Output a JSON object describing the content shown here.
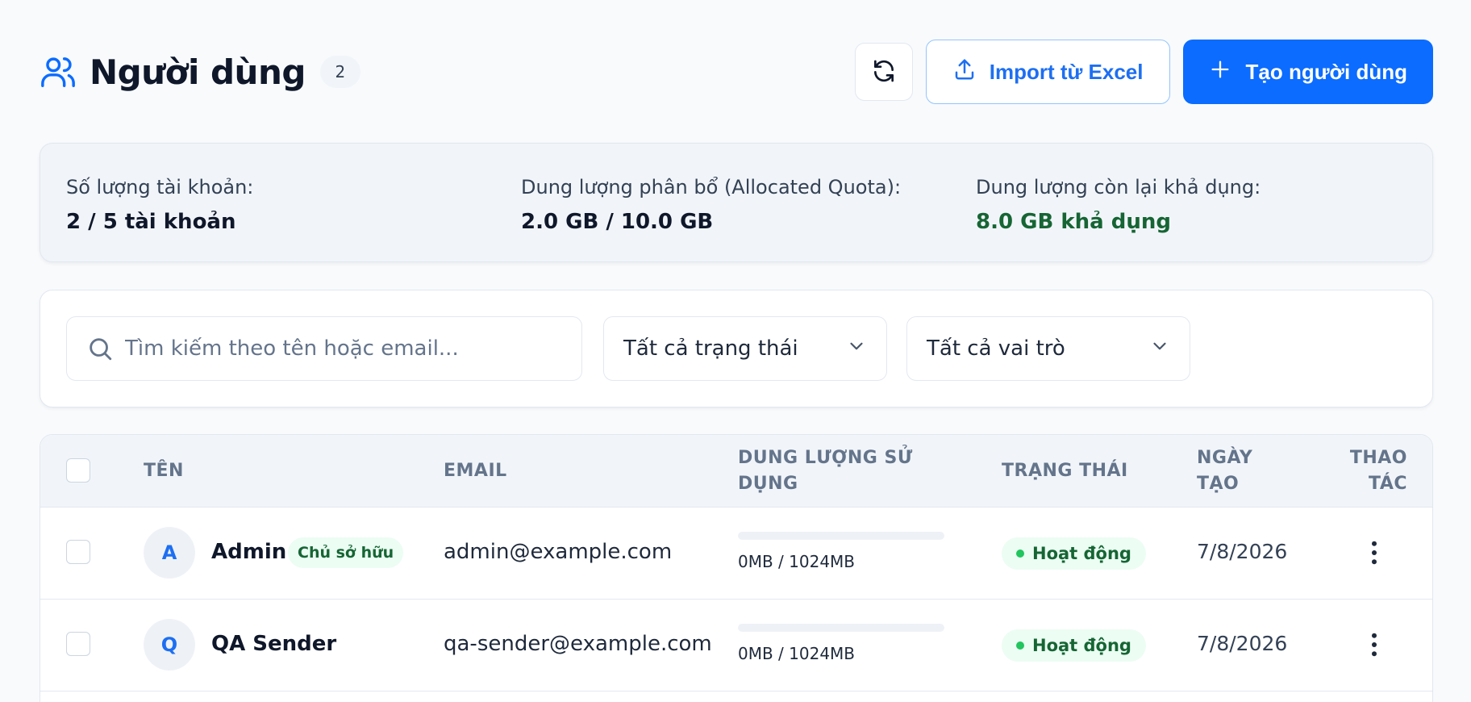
{
  "header": {
    "title": "Người dùng",
    "count": "2",
    "import_label": "Import từ Excel",
    "create_label": "Tạo người dùng"
  },
  "stats": {
    "accounts": {
      "label": "Số lượng tài khoản:",
      "value": "2 / 5 tài khoản"
    },
    "allocated": {
      "label": "Dung lượng phân bổ (Allocated Quota):",
      "value": "2.0 GB / 10.0 GB"
    },
    "remaining": {
      "label": "Dung lượng còn lại khả dụng:",
      "value": "8.0 GB khả dụng"
    }
  },
  "filters": {
    "search_placeholder": "Tìm kiếm theo tên hoặc email...",
    "search_value": "",
    "status_selected": "Tất cả trạng thái",
    "role_selected": "Tất cả vai trò"
  },
  "table": {
    "columns": {
      "name": "TÊN",
      "email": "EMAIL",
      "usage_line1": "DUNG LƯỢNG SỬ",
      "usage_line2": "DỤNG",
      "status": "TRẠNG THÁI",
      "created_line1": "NGÀY",
      "created_line2": "TẠO",
      "actions_line1": "THAO",
      "actions_line2": "TÁC"
    },
    "rows": [
      {
        "initial": "A",
        "name": "Admin",
        "badge": "Chủ sở hữu",
        "email": "admin@example.com",
        "usage": "0MB / 1024MB",
        "usage_fraction": 0,
        "status": "Hoạt động",
        "created": "7/8/2026"
      },
      {
        "initial": "Q",
        "name": "QA Sender",
        "email": "qa-sender@example.com",
        "usage": "0MB / 1024MB",
        "usage_fraction": 0,
        "status": "Hoạt động",
        "created": "7/8/2026"
      }
    ]
  },
  "colors": {
    "primary": "#0b6cff",
    "success_text": "#166534",
    "success_bg": "#ecfdf3",
    "success_dot": "#22c55e"
  },
  "icons": {
    "title": "users-icon",
    "refresh": "refresh-icon",
    "import": "upload-icon",
    "create": "plus-icon",
    "search": "search-icon",
    "dropdown": "chevron-down-icon",
    "row_actions": "more-vertical-icon"
  }
}
